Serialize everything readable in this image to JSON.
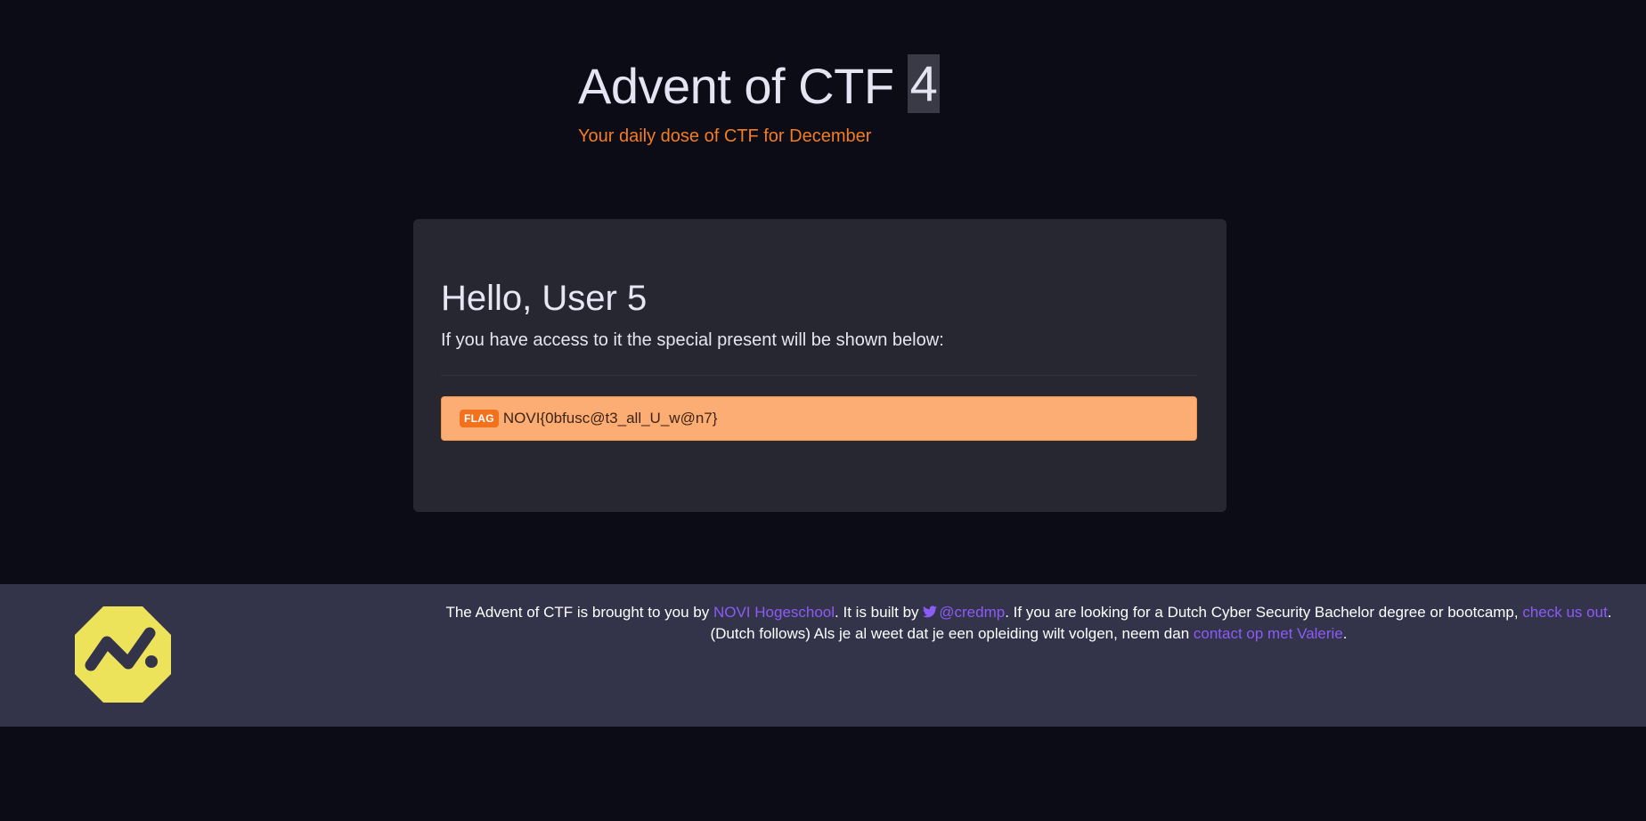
{
  "header": {
    "title": "Advent of CTF",
    "title_number": "4",
    "tagline": "Your daily dose of CTF for December"
  },
  "card": {
    "greeting": "Hello, User 5",
    "intro": "If you have access to it the special present will be shown below:",
    "flag_badge": "FLAG",
    "flag_value": "NOVI{0bfusc@t3_all_U_w@n7}"
  },
  "footer": {
    "text_1": "The Advent of CTF is brought to you by ",
    "link_novi": "NOVI Hogeschool",
    "text_2": ". It is built by ",
    "link_credmp": "@credmp",
    "text_3": ". If you are looking for a Dutch Cyber Security Bachelor degree or bootcamp, ",
    "link_check": "check us out",
    "text_4": ". (Dutch follows) Als je al weet dat je een opleiding wilt volgen, neem dan ",
    "link_contact": "contact op met Valerie",
    "text_5": ".",
    "logo_icon": "novi-logo-icon",
    "twitter_icon": "twitter-bird-icon"
  },
  "colors": {
    "background": "#0c0c16",
    "card": "#272732",
    "accent_orange": "#f57c22",
    "flag_bg": "#fbad73",
    "link": "#8b5cf6",
    "footer_bg": "#33334a",
    "logo_yellow": "#ede35b"
  }
}
